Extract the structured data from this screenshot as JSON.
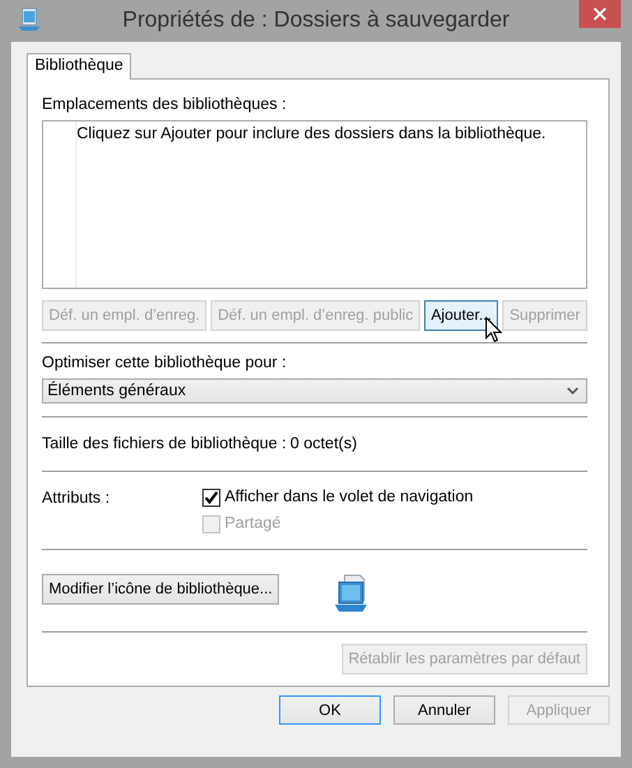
{
  "window": {
    "title": "Propriétés de : Dossiers à sauvegarder"
  },
  "tabs": [
    {
      "label": "Bibliothèque",
      "selected": true
    }
  ],
  "locations": {
    "label": "Emplacements des bibliothèques :",
    "hint": "Cliquez sur Ajouter pour inclure des dossiers dans la bibliothèque.",
    "buttons": [
      {
        "label": "Déf. un empl. d’enreg.",
        "disabled": true,
        "hovered": false
      },
      {
        "label": "Déf. un empl. d’enreg. public",
        "disabled": true,
        "hovered": false
      },
      {
        "label": "Ajouter...",
        "disabled": false,
        "hovered": true
      },
      {
        "label": "Supprimer",
        "disabled": true,
        "hovered": false
      }
    ]
  },
  "optimize": {
    "label": "Optimiser cette bibliothèque pour :",
    "value": "Éléments généraux"
  },
  "size": {
    "label": "Taille des fichiers de bibliothèque :",
    "value": "0 octet(s)"
  },
  "attributes": {
    "label": "Attributs :",
    "options": [
      {
        "label": "Afficher dans le volet de navigation",
        "checked": true,
        "disabled": false
      },
      {
        "label": "Partagé",
        "checked": false,
        "disabled": true
      }
    ]
  },
  "icon_button": {
    "label": "Modifier l’icône de bibliothèque..."
  },
  "restore_button": {
    "label": "Rétablir les paramètres par défaut",
    "disabled": true
  },
  "footer_buttons": [
    {
      "label": "OK",
      "default": true,
      "disabled": false
    },
    {
      "label": "Annuler",
      "default": false,
      "disabled": false
    },
    {
      "label": "Appliquer",
      "default": false,
      "disabled": true
    }
  ]
}
